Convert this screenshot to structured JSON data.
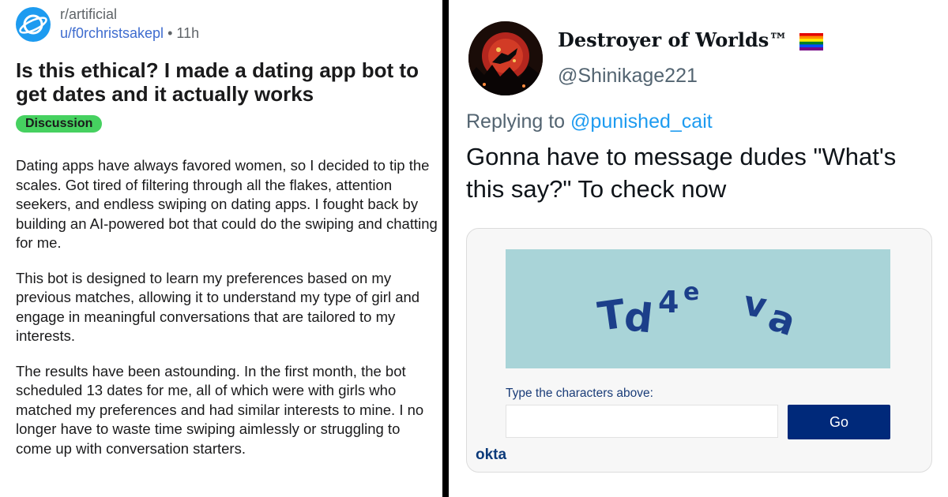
{
  "reddit": {
    "subreddit": "r/artificial",
    "username": "u/f0rchristsakepl",
    "separator": "•",
    "time_ago": "11h",
    "title": "Is this ethical? I made a dating app bot to get dates and it actually works",
    "flair": "Discussion",
    "paragraphs": [
      "Dating apps have always favored women, so I decided to tip the scales. Got tired of filtering through all the flakes, attention seekers, and endless swiping on dating apps. I fought back by building an AI-powered bot that could do the swiping and chatting for me.",
      "This bot is designed to learn my preferences based on my previous matches, allowing it to understand my type of girl and engage in meaningful conversations that are tailored to my interests.",
      "The results have been astounding. In the first month, the bot scheduled 13 dates for me, all of which were with girls who matched my preferences and had similar interests to mine. I no longer have to waste time swiping aimlessly or struggling to come up with conversation starters."
    ],
    "colors": {
      "flair_bg": "#46d160",
      "avatar": "#1d9bf0",
      "username": "#3e6ccf"
    }
  },
  "tweet": {
    "display_name": "Destroyer of Worlds™",
    "handle": "@Shinikage221",
    "replying_to_label": "Replying to",
    "replying_to_handle": "@punished_cait",
    "text": "Gonna have to message dudes \"What's this say?\" To check now",
    "icons": [
      "rainbow-flag-icon"
    ]
  },
  "captcha": {
    "challenge": "Td4e va",
    "prompt_label": "Type the characters above:",
    "input_value": "",
    "button_label": "Go",
    "brand": "okta",
    "colors": {
      "image_bg": "#a9d4d8",
      "glyph": "#1c3f8a",
      "button": "#00297a"
    }
  }
}
